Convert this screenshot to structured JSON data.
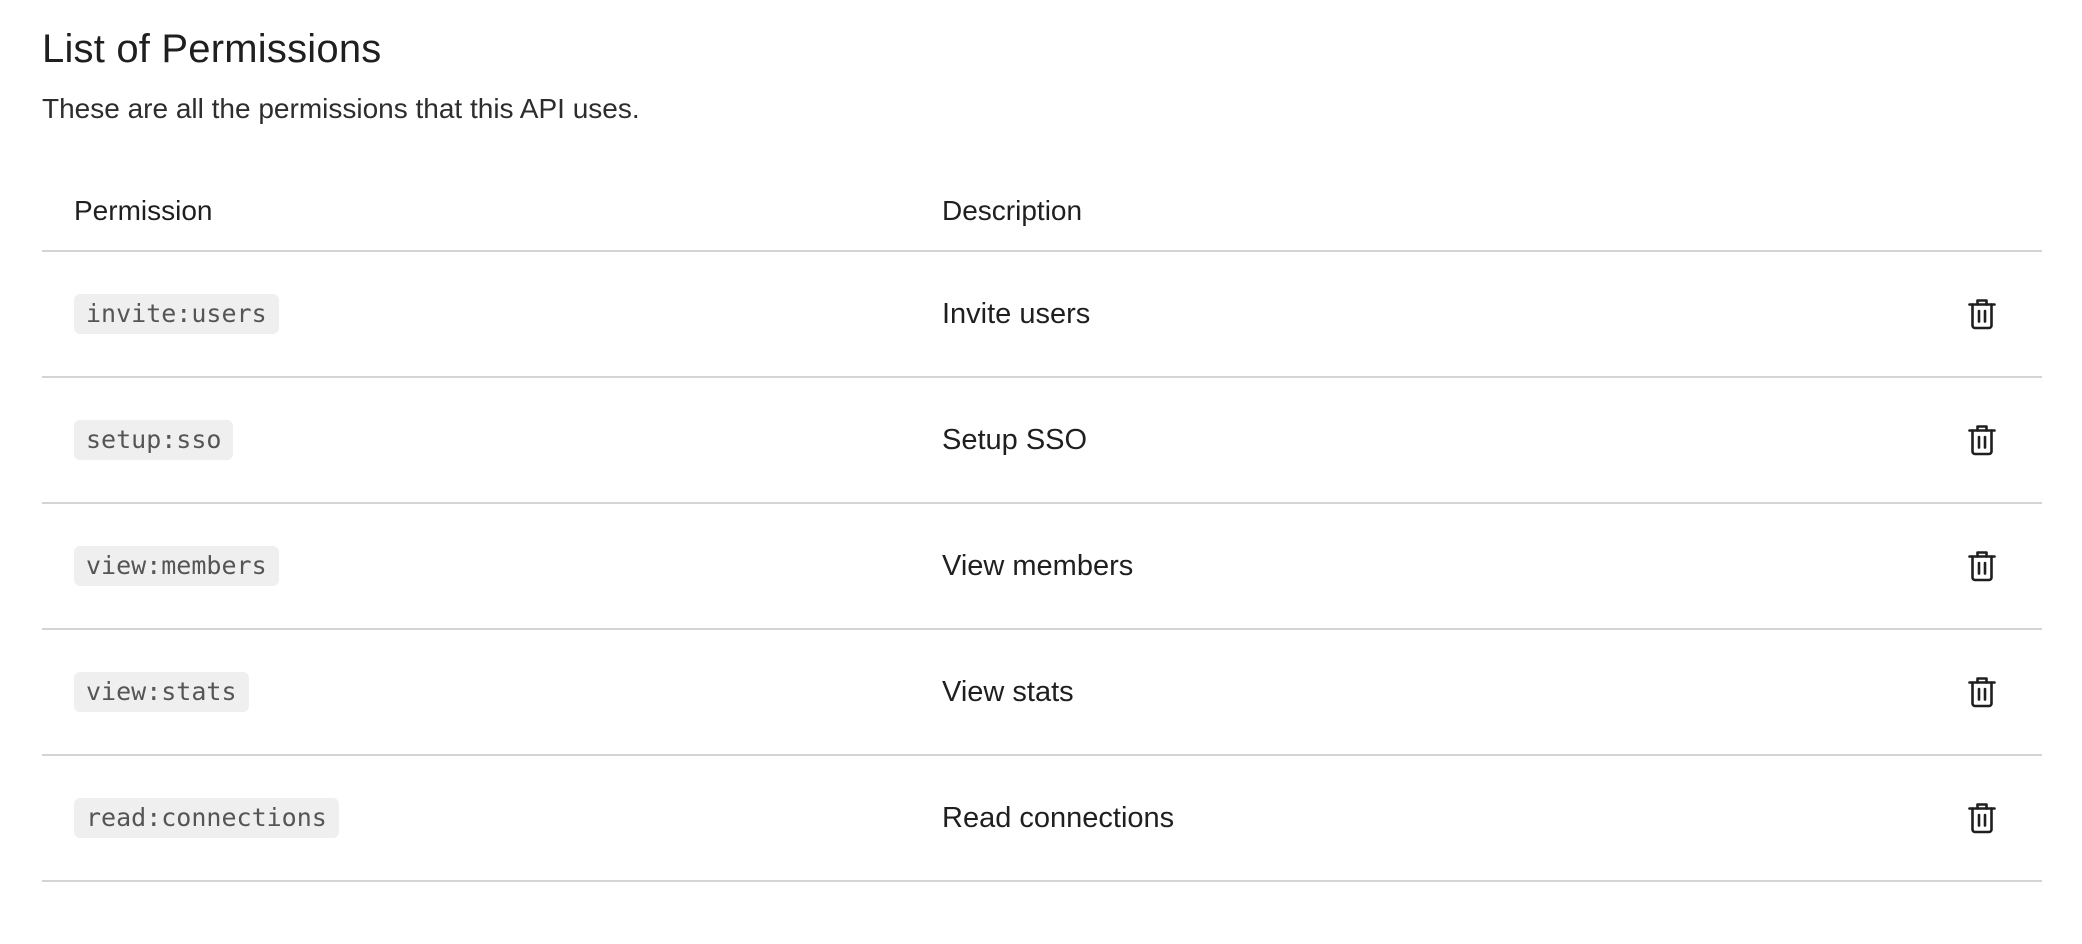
{
  "page": {
    "title": "List of Permissions",
    "subtitle": "These are all the permissions that this API uses."
  },
  "table": {
    "headers": {
      "permission": "Permission",
      "description": "Description"
    },
    "rows": [
      {
        "permission": "invite:users",
        "description": "Invite users",
        "action_icon": "trash-icon"
      },
      {
        "permission": "setup:sso",
        "description": "Setup SSO",
        "action_icon": "trash-icon"
      },
      {
        "permission": "view:members",
        "description": "View members",
        "action_icon": "trash-icon"
      },
      {
        "permission": "view:stats",
        "description": "View stats",
        "action_icon": "trash-icon"
      },
      {
        "permission": "read:connections",
        "description": "Read connections",
        "action_icon": "trash-icon"
      }
    ]
  },
  "colors": {
    "text": "#1f1f1f",
    "divider": "#d4d4d4",
    "chip_background": "#efefef",
    "chip_text": "#555555"
  }
}
